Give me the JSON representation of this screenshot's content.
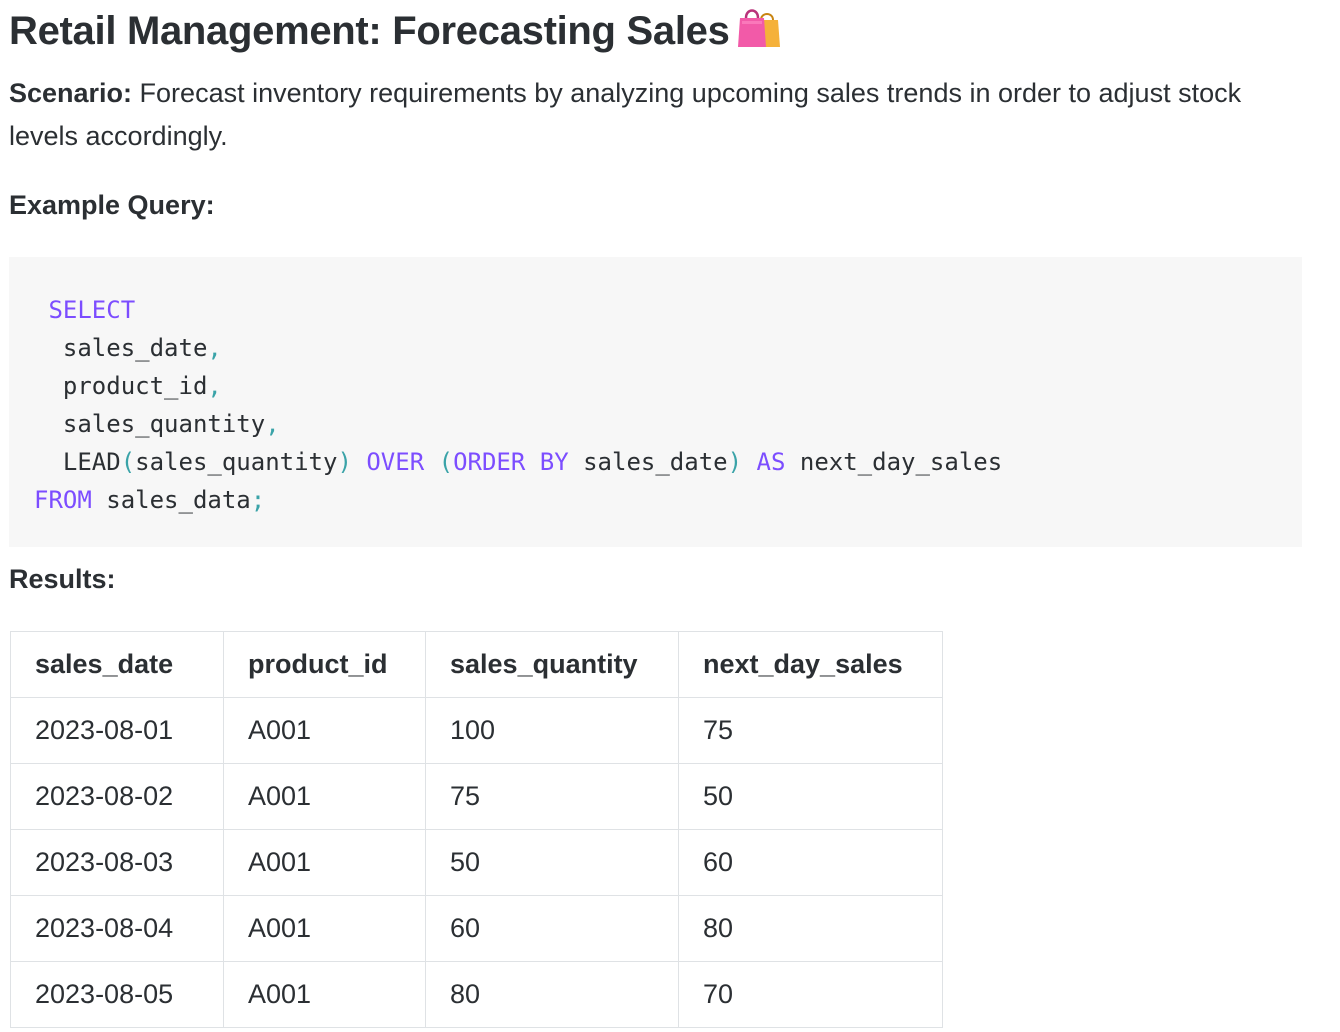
{
  "title": "Retail Management: Forecasting Sales",
  "title_icon": "shopping-bags-icon",
  "scenario": {
    "label": "Scenario:",
    "text": " Forecast inventory requirements by analyzing upcoming sales trends in order to adjust stock levels accordingly."
  },
  "example_query_label": "Example Query:",
  "code": {
    "select": "SELECT",
    "col1": "sales_date",
    "col2": "product_id",
    "col3": "sales_quantity",
    "lead_fn": "LEAD",
    "lead_arg": "sales_quantity",
    "over": "OVER",
    "order_by": "ORDER BY",
    "order_col": "sales_date",
    "as": "AS",
    "alias": "next_day_sales",
    "from": "FROM",
    "table": "sales_data"
  },
  "results_label": "Results:",
  "results": {
    "columns": [
      "sales_date",
      "product_id",
      "sales_quantity",
      "next_day_sales"
    ],
    "rows": [
      [
        "2023-08-01",
        "A001",
        "100",
        "75"
      ],
      [
        "2023-08-02",
        "A001",
        "75",
        "50"
      ],
      [
        "2023-08-03",
        "A001",
        "50",
        "60"
      ],
      [
        "2023-08-04",
        "A001",
        "60",
        "80"
      ],
      [
        "2023-08-05",
        "A001",
        "80",
        "70"
      ]
    ]
  },
  "colors": {
    "keyword": "#7c4dff",
    "punctuation": "#3aa3a8",
    "code_background": "#f7f7f7",
    "text": "#2b2f33"
  }
}
